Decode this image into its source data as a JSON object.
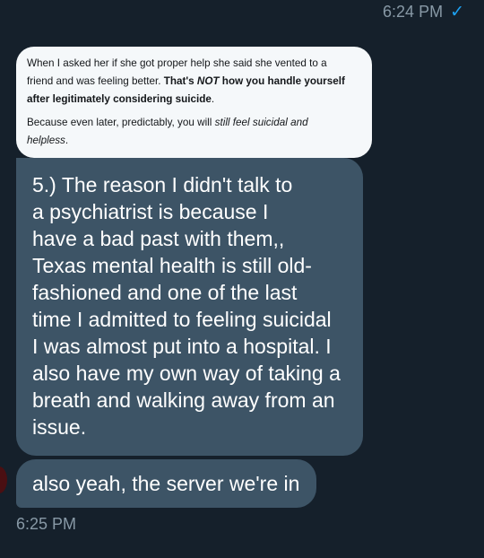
{
  "header": {
    "timestamp": "6:24 PM",
    "status_icon": "check-icon"
  },
  "quote": {
    "p1_a": "When I asked her if she got proper help she said she vented to a",
    "p1_b": "friend and was feeling better. ",
    "p1_c": "That's ",
    "p1_d": "NOT",
    "p1_e": " how you handle yourself",
    "p1_f": "after legitimately considering suicide",
    "p1_g": ".",
    "p2_a": "Because even later, predictably, you will ",
    "p2_b": "still feel suicidal and",
    "p2_c": "helpless",
    "p2_d": "."
  },
  "messages": {
    "main_lines": [
      "5.) The reason I didn't talk to",
      "a psychiatrist is because I",
      "have a bad past with them,,",
      "Texas mental health is still old-",
      "fashioned and one of the last",
      "time I admitted to feeling suicidal",
      "I was almost put into a hospital. I",
      "also have my own way of taking a",
      "breath and walking away from an",
      "issue."
    ],
    "second": "also yeah, the server we're in"
  },
  "footer": {
    "timestamp": "6:25 PM"
  },
  "colors": {
    "background": "#15202b",
    "bubble": "#3d5466",
    "quote_background": "#f5f8fa",
    "accent": "#1da1f2"
  }
}
